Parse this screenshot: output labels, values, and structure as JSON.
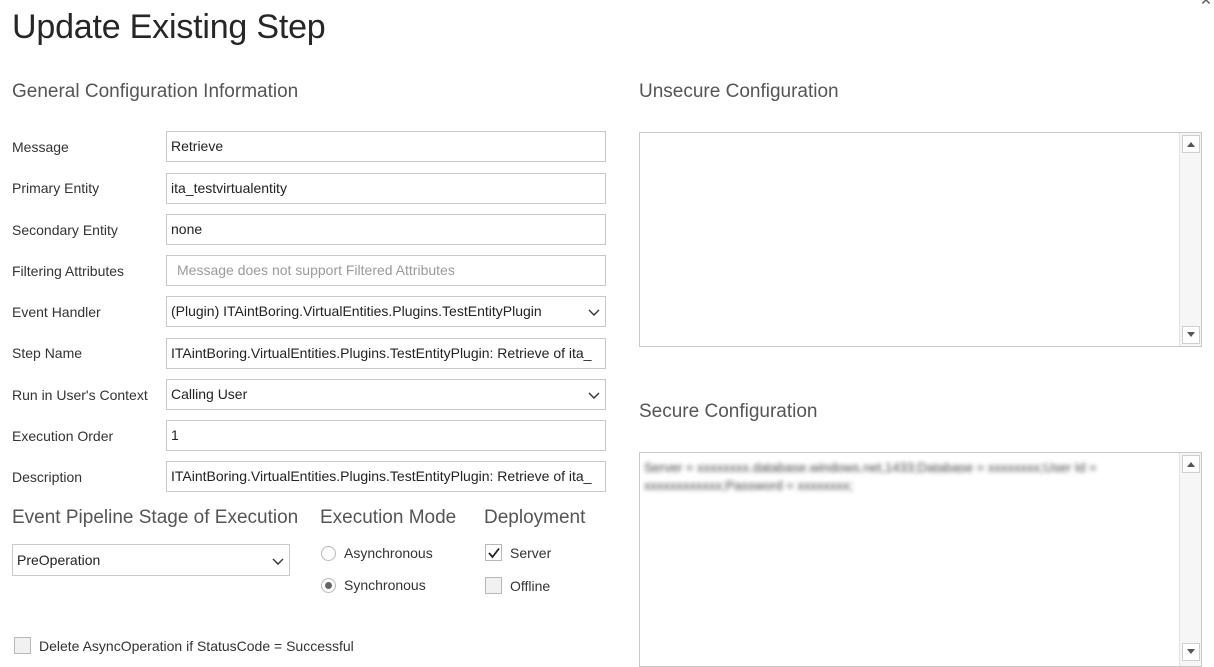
{
  "dialog": {
    "title": "Update Existing Step"
  },
  "general": {
    "heading": "General Configuration Information",
    "fields": [
      {
        "label": "Message",
        "value": "Retrieve"
      },
      {
        "label": "Primary Entity",
        "value": "ita_testvirtualentity"
      },
      {
        "label": "Secondary Entity",
        "value": "none"
      },
      {
        "label": "Filtering Attributes",
        "placeholder": "Message does not support Filtered Attributes"
      },
      {
        "label": "Event Handler",
        "value": "(Plugin) ITAintBoring.VirtualEntities.Plugins.TestEntityPlugin"
      },
      {
        "label": "Step Name",
        "value": "ITAintBoring.VirtualEntities.Plugins.TestEntityPlugin: Retrieve of ita_"
      },
      {
        "label": "Run in User's Context",
        "value": "Calling User"
      },
      {
        "label": "Execution Order",
        "value": "1"
      },
      {
        "label": "Description",
        "value": "ITAintBoring.VirtualEntities.Plugins.TestEntityPlugin: Retrieve of ita_"
      }
    ]
  },
  "pipeline": {
    "heading": "Event Pipeline Stage of Execution",
    "selected": "PreOperation"
  },
  "execution_mode": {
    "heading": "Execution Mode",
    "options": [
      {
        "label": "Asynchronous",
        "checked": false
      },
      {
        "label": "Synchronous",
        "checked": true
      }
    ]
  },
  "deployment": {
    "heading": "Deployment",
    "options": [
      {
        "label": "Server",
        "checked": true
      },
      {
        "label": "Offline",
        "checked": false
      }
    ]
  },
  "delete_async": {
    "label": "Delete AsyncOperation if StatusCode = Successful",
    "checked": false
  },
  "unsecure": {
    "heading": "Unsecure  Configuration",
    "value": ""
  },
  "secure": {
    "heading": "Secure  Configuration",
    "value": "Server = xxxxxxxx.database.windows.net,1433;Database = xxxxxxxx;User Id = xxxxxxxxxxxx;Password = xxxxxxxx;"
  }
}
